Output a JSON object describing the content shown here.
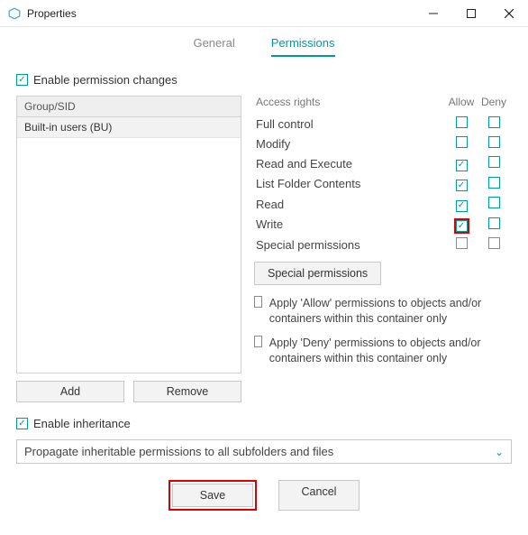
{
  "window": {
    "title": "Properties"
  },
  "tabs": {
    "general": "General",
    "permissions": "Permissions"
  },
  "enable_permission_changes": {
    "label": "Enable permission changes",
    "checked": true
  },
  "group_sid": {
    "header": "Group/SID",
    "rows": [
      "Built-in users (BU)"
    ],
    "add": "Add",
    "remove": "Remove"
  },
  "rights": {
    "header": "Access rights",
    "allow": "Allow",
    "deny": "Deny",
    "items": [
      {
        "label": "Full control",
        "allow": false,
        "deny": false
      },
      {
        "label": "Modify",
        "allow": false,
        "deny": false
      },
      {
        "label": "Read and Execute",
        "allow": true,
        "deny": false
      },
      {
        "label": "List Folder Contents",
        "allow": true,
        "deny": false
      },
      {
        "label": "Read",
        "allow": true,
        "deny": false
      },
      {
        "label": "Write",
        "allow": true,
        "deny": false,
        "allow_highlight": true
      },
      {
        "label": "Special permissions",
        "allow": false,
        "deny": false,
        "disabled": true
      }
    ],
    "special_btn": "Special permissions"
  },
  "apply_allow": {
    "checked": false,
    "text": "Apply 'Allow' permissions to objects and/or containers within this container only"
  },
  "apply_deny": {
    "checked": false,
    "text": "Apply 'Deny' permissions to objects and/or containers within this container only"
  },
  "inheritance": {
    "enable_label": "Enable inheritance",
    "enable_checked": true,
    "dropdown_value": "Propagate inheritable permissions to all subfolders and files"
  },
  "footer": {
    "save": "Save",
    "cancel": "Cancel"
  }
}
